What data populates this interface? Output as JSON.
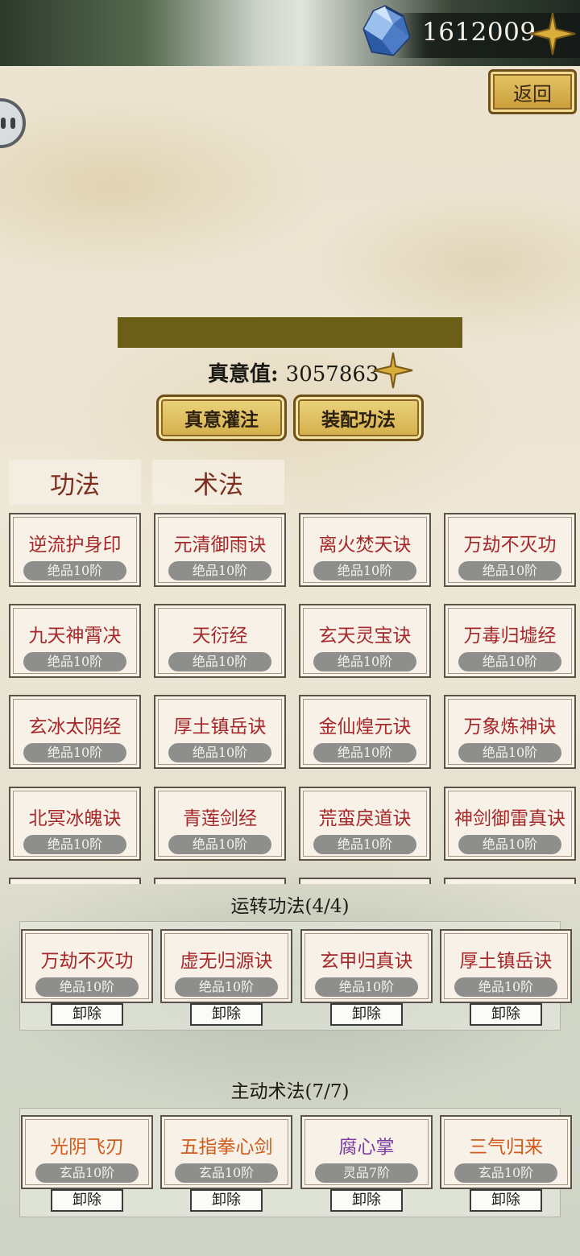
{
  "currency": {
    "value": "1612009"
  },
  "back_button": {
    "label": "返回"
  },
  "zhenyi": {
    "label": "真意值:",
    "value": "3057863"
  },
  "actions": {
    "infuse_label": "真意灌注",
    "equip_label": "装配功法"
  },
  "tabs": [
    {
      "label": "功法"
    },
    {
      "label": "术法"
    }
  ],
  "skills": [
    {
      "name": "逆流护身印",
      "grade": "绝品10阶"
    },
    {
      "name": "元清御雨诀",
      "grade": "绝品10阶"
    },
    {
      "name": "离火焚天诀",
      "grade": "绝品10阶"
    },
    {
      "name": "万劫不灭功",
      "grade": "绝品10阶"
    },
    {
      "name": "九天神霄决",
      "grade": "绝品10阶"
    },
    {
      "name": "天衍经",
      "grade": "绝品10阶"
    },
    {
      "name": "玄天灵宝诀",
      "grade": "绝品10阶"
    },
    {
      "name": "万毒归墟经",
      "grade": "绝品10阶"
    },
    {
      "name": "玄冰太阴经",
      "grade": "绝品10阶"
    },
    {
      "name": "厚土镇岳诀",
      "grade": "绝品10阶"
    },
    {
      "name": "金仙煌元诀",
      "grade": "绝品10阶"
    },
    {
      "name": "万象炼神诀",
      "grade": "绝品10阶"
    },
    {
      "name": "北冥冰魄诀",
      "grade": "绝品10阶"
    },
    {
      "name": "青莲剑经",
      "grade": "绝品10阶"
    },
    {
      "name": "荒蛮戾道诀",
      "grade": "绝品10阶"
    },
    {
      "name": "神剑御雷真诀",
      "grade": "绝品10阶"
    }
  ],
  "running": {
    "title": "运转功法(4/4)",
    "unequip_label": "卸除",
    "items": [
      {
        "name": "万劫不灭功",
        "grade": "绝品10阶"
      },
      {
        "name": "虚无归源诀",
        "grade": "绝品10阶"
      },
      {
        "name": "玄甲归真诀",
        "grade": "绝品10阶"
      },
      {
        "name": "厚土镇岳诀",
        "grade": "绝品10阶"
      }
    ]
  },
  "active": {
    "title": "主动术法(7/7)",
    "unequip_label": "卸除",
    "items": [
      {
        "name": "光阴飞刃",
        "grade": "玄品10阶",
        "color": "#cf5b1c"
      },
      {
        "name": "五指拳心剑",
        "grade": "玄品10阶",
        "color": "#cf5b1c"
      },
      {
        "name": "腐心掌",
        "grade": "灵品7阶",
        "color": "#7b3fa0"
      },
      {
        "name": "三气归来",
        "grade": "玄品10阶",
        "color": "#cf5b1c"
      }
    ]
  },
  "colors": {
    "accent_gold": "#d8ad3c",
    "skill_red": "#a5282b",
    "progress": "#6b5f17"
  }
}
